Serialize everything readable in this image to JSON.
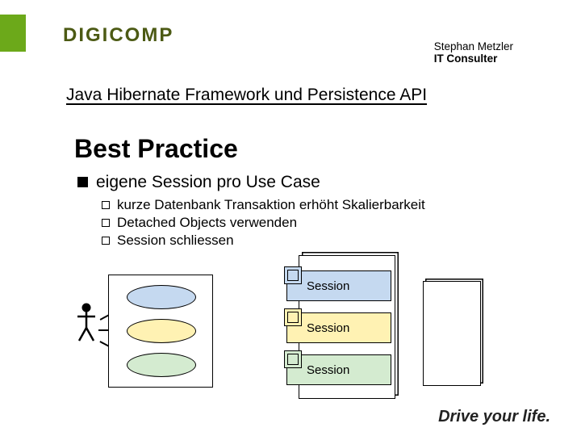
{
  "brand": {
    "logo": "DIGICOMP",
    "slogan": "Drive your life."
  },
  "author": {
    "name": "Stephan Metzler",
    "title": "IT Consulter"
  },
  "page_title": "Java Hibernate Framework und Persistence API",
  "heading": "Best Practice",
  "bullet1": "eigene Session pro Use Case",
  "bullets2": [
    "kurze Datenbank Transaktion erhöht Skalierbarkeit",
    "Detached Objects verwenden",
    "Session schliessen"
  ],
  "diagram": {
    "session_label": "Session",
    "sessions": [
      "Session",
      "Session",
      "Session"
    ]
  }
}
